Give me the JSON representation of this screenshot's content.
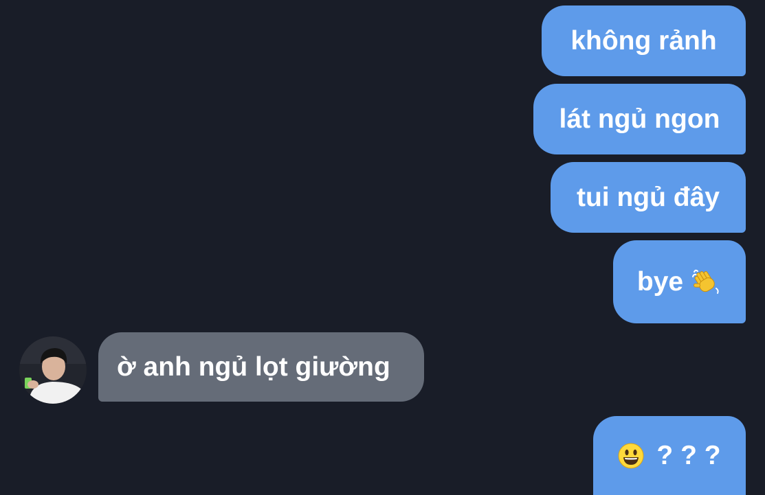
{
  "conversation": {
    "messages": [
      {
        "direction": "outgoing",
        "text": "không rảnh"
      },
      {
        "direction": "outgoing",
        "text": "lát ngủ ngon"
      },
      {
        "direction": "outgoing",
        "text": "tui ngủ đây"
      },
      {
        "direction": "outgoing",
        "text": "bye",
        "emoji": "waving-hand-icon"
      },
      {
        "direction": "incoming",
        "text": "ờ anh ngủ lọt giường",
        "avatar": "contact-avatar"
      },
      {
        "direction": "outgoing",
        "emoji": "grinning-face-icon",
        "text": "? ? ?"
      }
    ]
  },
  "colors": {
    "background": "#191d28",
    "outgoing_bubble": "#5e9bea",
    "incoming_bubble": "#656c78",
    "text": "#ffffff"
  }
}
